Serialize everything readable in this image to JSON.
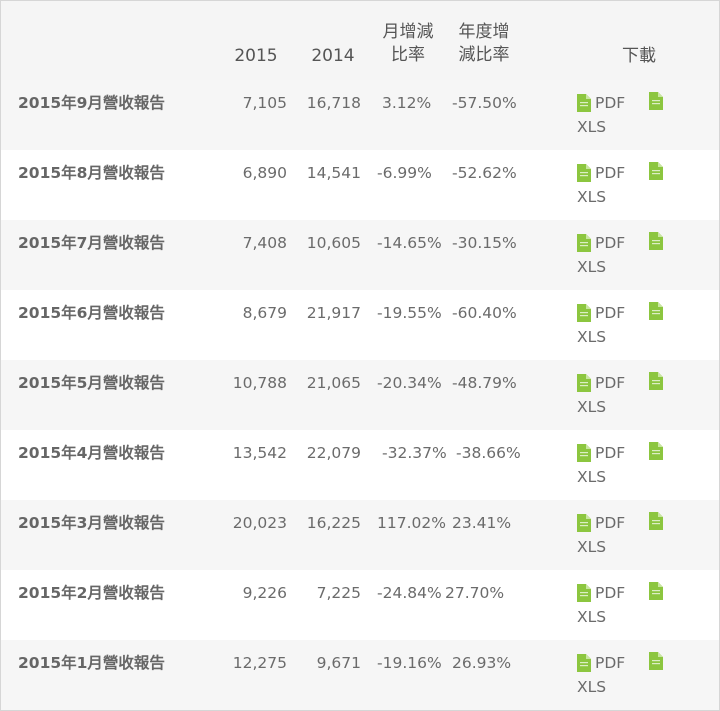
{
  "header": {
    "col_2015": "2015",
    "col_2014": "2014",
    "col_mom_line1": "月增減",
    "col_mom_line2": "比率",
    "col_yoy_line1": "年度增",
    "col_yoy_line2": "減比率",
    "col_download": "下載"
  },
  "icons": {
    "file": "file-icon",
    "color": "#8cc63f"
  },
  "rows": [
    {
      "label": "2015年9月營收報告",
      "v2015": "7,105",
      "v2014": "16,718",
      "mom": "3.12%",
      "yoy": "-57.50%",
      "pdf": "PDF",
      "xls": "XLS"
    },
    {
      "label": "2015年8月營收報告",
      "v2015": "6,890",
      "v2014": "14,541",
      "mom": "-6.99%",
      "yoy": "-52.62%",
      "pdf": "PDF",
      "xls": "XLS"
    },
    {
      "label": "2015年7月營收報告",
      "v2015": "7,408",
      "v2014": "10,605",
      "mom": "-14.65%",
      "yoy": "-30.15%",
      "pdf": "PDF",
      "xls": "XLS"
    },
    {
      "label": "2015年6月營收報告",
      "v2015": "8,679",
      "v2014": "21,917",
      "mom": "-19.55%",
      "yoy": "-60.40%",
      "pdf": "PDF",
      "xls": "XLS"
    },
    {
      "label": "2015年5月營收報告",
      "v2015": "10,788",
      "v2014": "21,065",
      "mom": "-20.34%",
      "yoy": "-48.79%",
      "pdf": "PDF",
      "xls": "XLS"
    },
    {
      "label": "2015年4月營收報告",
      "v2015": "13,542",
      "v2014": "22,079",
      "mom": "-32.37%",
      "yoy": "-38.66%",
      "pdf": "PDF",
      "xls": "XLS"
    },
    {
      "label": "2015年3月營收報告",
      "v2015": "20,023",
      "v2014": "16,225",
      "mom": "117.02%",
      "yoy": "23.41%",
      "pdf": "PDF",
      "xls": "XLS"
    },
    {
      "label": "2015年2月營收報告",
      "v2015": "9,226",
      "v2014": "7,225",
      "mom": "-24.84%",
      "yoy": "27.70%",
      "pdf": "PDF",
      "xls": "XLS"
    },
    {
      "label": "2015年1月營收報告",
      "v2015": "12,275",
      "v2014": "9,671",
      "mom": "-19.16%",
      "yoy": "26.93%",
      "pdf": "PDF",
      "xls": "XLS"
    }
  ]
}
